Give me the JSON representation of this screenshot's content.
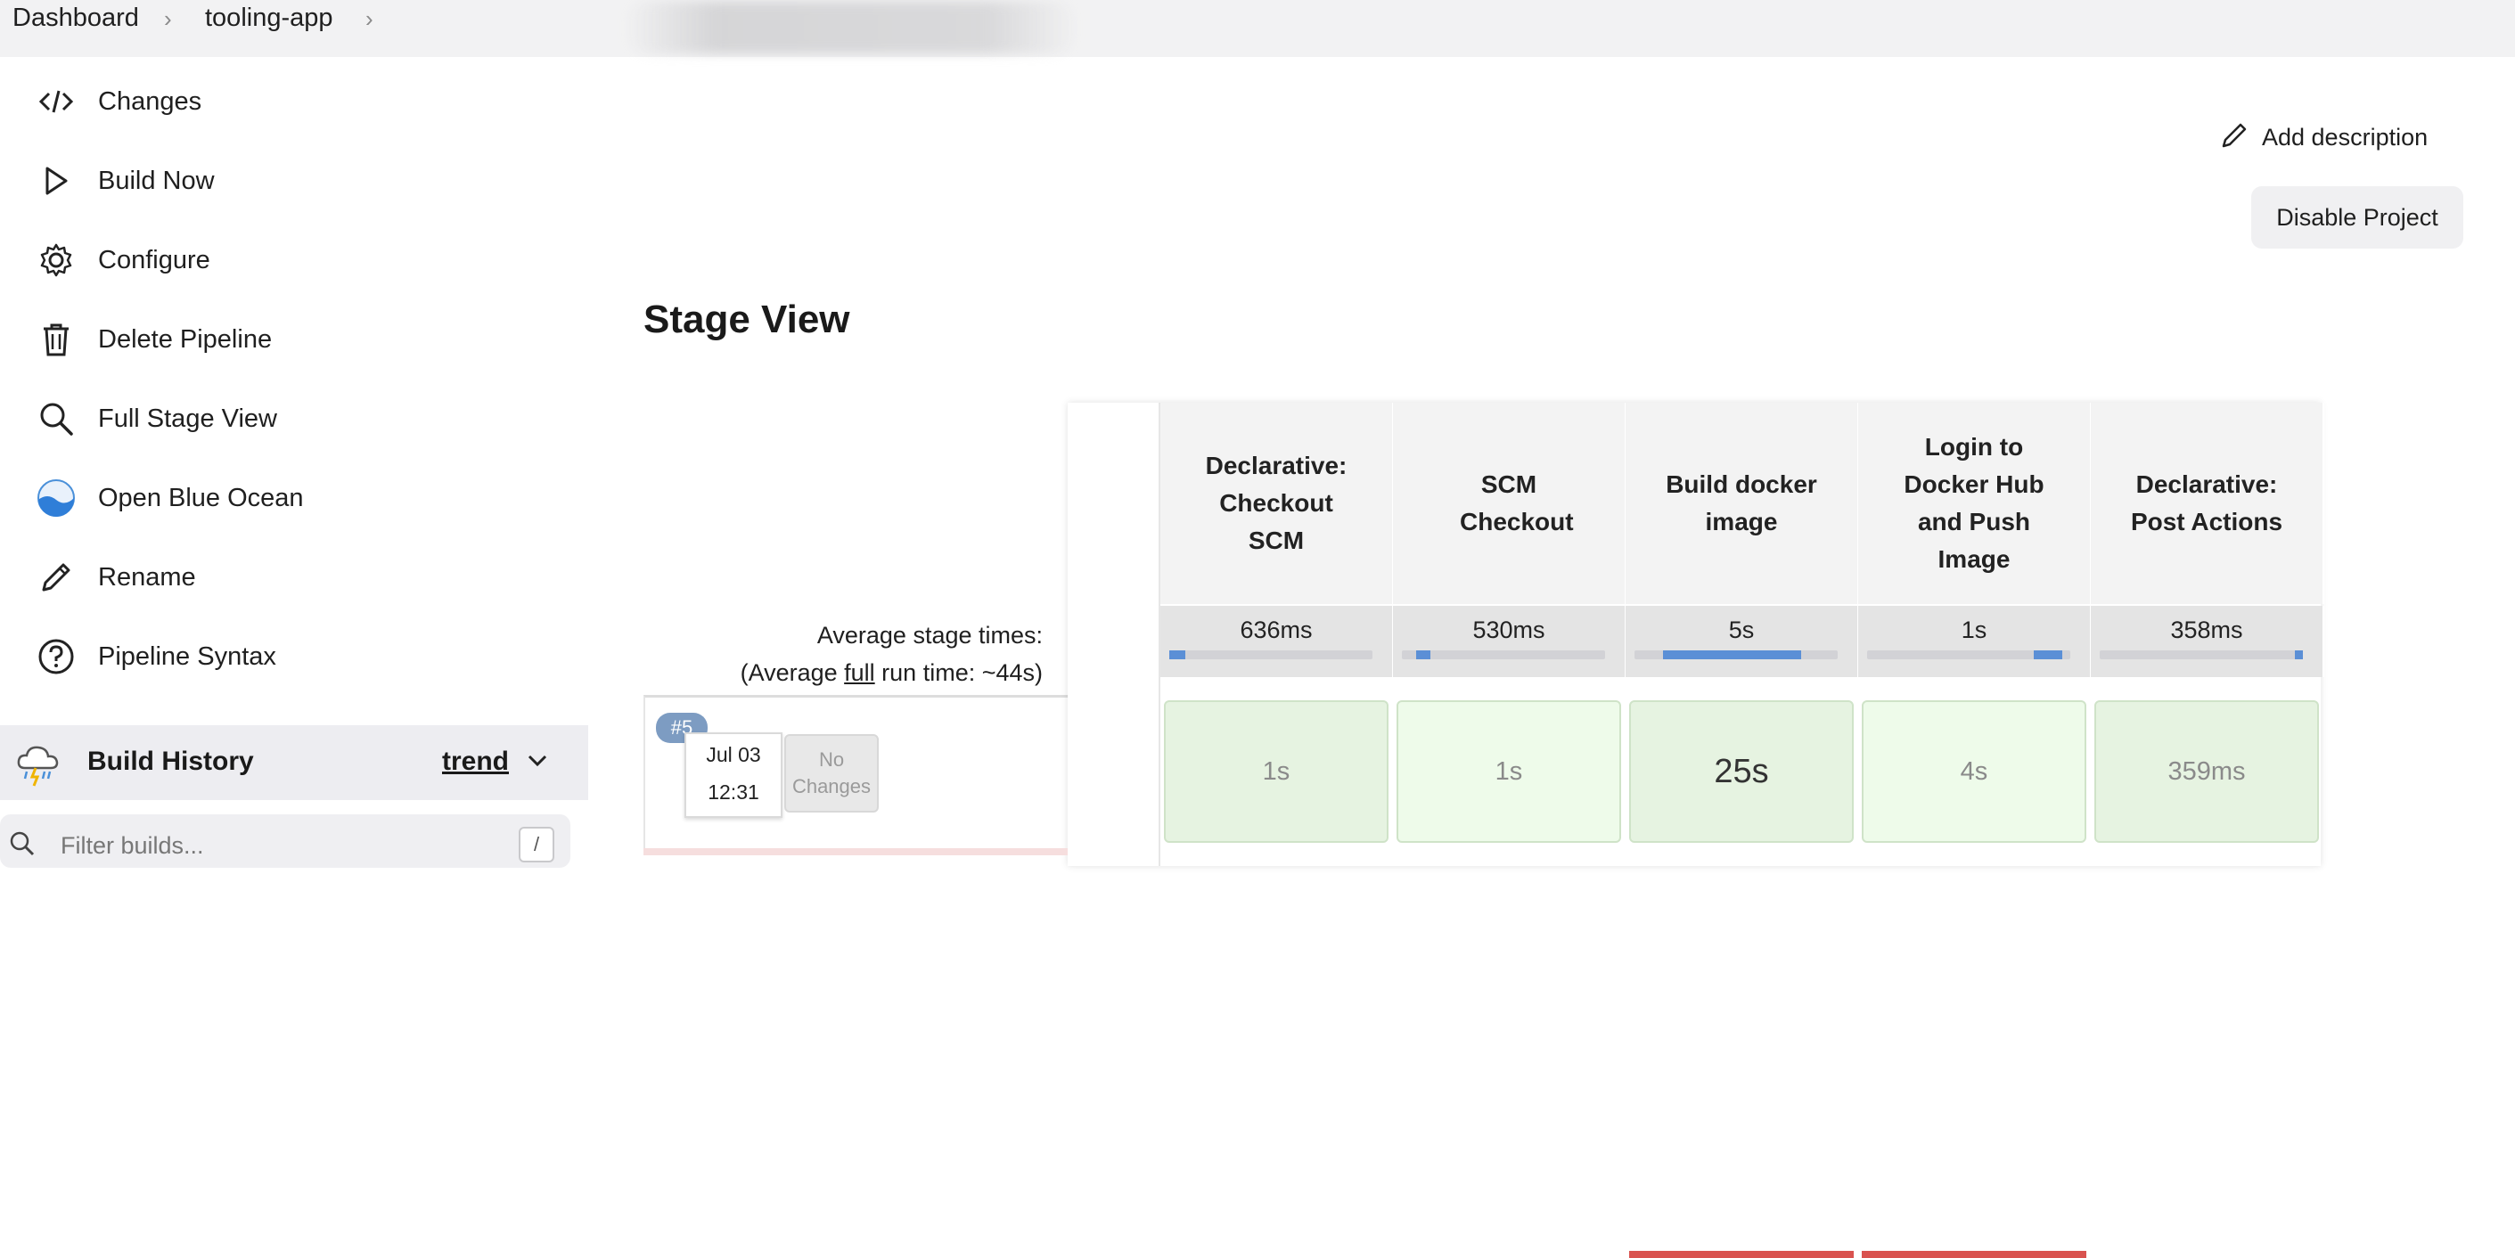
{
  "breadcrumb": {
    "items": [
      "Dashboard",
      "tooling-app"
    ]
  },
  "sidebar": {
    "items": [
      {
        "label": "Changes",
        "icon": "code-icon"
      },
      {
        "label": "Build Now",
        "icon": "play-icon"
      },
      {
        "label": "Configure",
        "icon": "gear-icon"
      },
      {
        "label": "Delete Pipeline",
        "icon": "trash-icon"
      },
      {
        "label": "Full Stage View",
        "icon": "search-icon"
      },
      {
        "label": "Open Blue Ocean",
        "icon": "blue-ocean-icon"
      },
      {
        "label": "Rename",
        "icon": "pencil-icon"
      },
      {
        "label": "Pipeline Syntax",
        "icon": "help-icon"
      }
    ],
    "build_history": {
      "title": "Build History",
      "trend": "trend"
    },
    "filter": {
      "placeholder": "Filter builds...",
      "shortcut": "/"
    }
  },
  "actions": {
    "add_description": "Add description",
    "disable_project": "Disable Project"
  },
  "stage_view": {
    "title": "Stage View",
    "avg_label_line1": "Average stage times:",
    "avg_label_prefix": "(Average ",
    "avg_label_full": "full",
    "avg_label_suffix": " run time: ~44s)",
    "stages": [
      {
        "name": "Declarative: Checkout SCM",
        "avg": "636ms",
        "bar_fill": 0.08,
        "bar_offset": 0.0
      },
      {
        "name": "SCM Checkout",
        "avg": "530ms",
        "bar_fill": 0.07,
        "bar_offset": 0.07
      },
      {
        "name": "Build docker image",
        "avg": "5s",
        "bar_fill": 0.68,
        "bar_offset": 0.14
      },
      {
        "name": "Login to Docker Hub and Push Image",
        "avg": "1s",
        "bar_fill": 0.14,
        "bar_offset": 0.82
      },
      {
        "name": "Declarative: Post Actions",
        "avg": "358ms",
        "bar_fill": 0.04,
        "bar_offset": 0.96
      }
    ],
    "builds": [
      {
        "number": "#5",
        "date": "Jul 03",
        "time": "12:31",
        "changes": "No Changes",
        "durations": [
          "1s",
          "1s",
          "25s",
          "4s",
          "359ms"
        ]
      }
    ]
  },
  "colors": {
    "success_cell": "#eaf6e6",
    "success_border": "#cfe3c8",
    "bar_fill": "#5b8fd6",
    "failed": "#d9534f"
  }
}
